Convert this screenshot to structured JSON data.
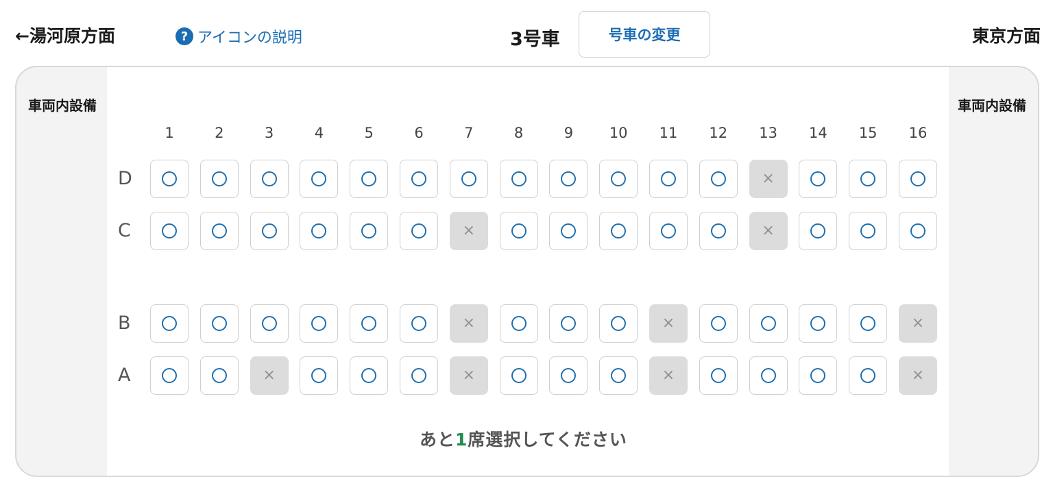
{
  "header": {
    "left_direction": "←湯河原方面",
    "right_direction": "東京方面",
    "help_label": "アイコンの説明",
    "help_icon": "?",
    "car_label": "3号車",
    "change_car_label": "号車の変更"
  },
  "facility": {
    "left_label": "車両内設備",
    "right_label": "車両内設備"
  },
  "seat_map": {
    "columns": [
      "1",
      "2",
      "3",
      "4",
      "5",
      "6",
      "7",
      "8",
      "9",
      "10",
      "11",
      "12",
      "13",
      "14",
      "15",
      "16"
    ],
    "rows": [
      {
        "label": "D",
        "seats": [
          "○",
          "○",
          "○",
          "○",
          "○",
          "○",
          "○",
          "○",
          "○",
          "○",
          "○",
          "○",
          "×",
          "○",
          "○",
          "○"
        ]
      },
      {
        "label": "C",
        "seats": [
          "○",
          "○",
          "○",
          "○",
          "○",
          "○",
          "×",
          "○",
          "○",
          "○",
          "○",
          "○",
          "×",
          "○",
          "○",
          "○"
        ]
      },
      {
        "label": "B",
        "seats": [
          "○",
          "○",
          "○",
          "○",
          "○",
          "○",
          "×",
          "○",
          "○",
          "○",
          "×",
          "○",
          "○",
          "○",
          "○",
          "×"
        ]
      },
      {
        "label": "A",
        "seats": [
          "○",
          "○",
          "×",
          "○",
          "○",
          "○",
          "×",
          "○",
          "○",
          "○",
          "×",
          "○",
          "○",
          "○",
          "○",
          "×"
        ]
      }
    ],
    "available_symbol": "○",
    "taken_symbol": "×"
  },
  "footer": {
    "prefix": "あと",
    "count": "1",
    "suffix": "席選択してください"
  },
  "colors": {
    "accent": "#1b6db3",
    "count_green": "#1f8b4c",
    "taken_bg": "#dcdcdc"
  }
}
